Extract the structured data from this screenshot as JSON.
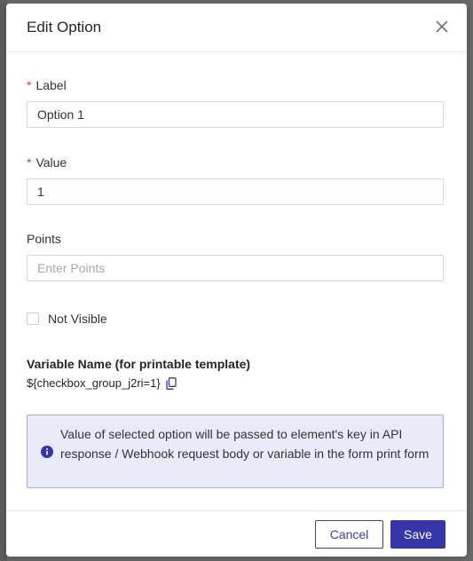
{
  "modal": {
    "title": "Edit Option"
  },
  "fields": {
    "label": {
      "required_mark": "*",
      "label": "Label",
      "value": "Option 1"
    },
    "value": {
      "required_mark": "*",
      "label": "Value",
      "value": "1"
    },
    "points": {
      "label": "Points",
      "value": "",
      "placeholder": "Enter Points"
    }
  },
  "not_visible": {
    "label": "Not Visible",
    "checked": false
  },
  "variable": {
    "title": "Variable Name (for printable template)",
    "value": "${checkbox_group_j2ri=1}"
  },
  "info": {
    "text": "Value of selected option will be passed to element's key in API response / Webhook request body or variable in the form print form"
  },
  "footer": {
    "cancel_label": "Cancel",
    "save_label": "Save"
  },
  "colors": {
    "primary": "#3537a8",
    "required": "#e0393e",
    "info_bg": "#eaebf8",
    "info_border": "#a7abd9"
  },
  "icons": {
    "close": "close-icon",
    "copy": "copy-icon",
    "info": "info-icon"
  }
}
